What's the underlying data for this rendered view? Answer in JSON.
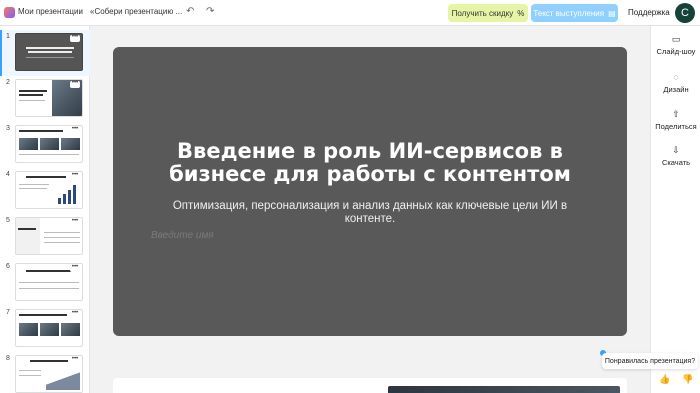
{
  "header": {
    "breadcrumb_home": "Мои презентации",
    "breadcrumb_sep": "›",
    "presentation_title": "«Собери презентацию ...",
    "undo_icon": "↶",
    "redo_icon": "↷",
    "discount_label": "Получить скидку",
    "discount_icon": "%",
    "speech_label": "Текст выступления",
    "speech_icon": "▤",
    "support_label": "Поддержка",
    "avatar_letter": "C"
  },
  "thumbnails": [
    {
      "num": "1"
    },
    {
      "num": "2"
    },
    {
      "num": "3"
    },
    {
      "num": "4"
    },
    {
      "num": "5"
    },
    {
      "num": "6"
    },
    {
      "num": "7"
    },
    {
      "num": "8"
    }
  ],
  "thumb_menu": "•••",
  "slide": {
    "title": "Введение в роль ИИ-сервисов в бизнесе для работы с контентом",
    "subtitle": "Оптимизация, персонализация и анализ данных как ключевые цели ИИ в контенте.",
    "name_placeholder": "Введите имя"
  },
  "tools": [
    {
      "icon": "▭",
      "label": "Слайд-шоу"
    },
    {
      "icon": "◌",
      "label": "Дизайн"
    },
    {
      "icon": "⇧",
      "label": "Поделиться"
    },
    {
      "icon": "⇩",
      "label": "Скачать"
    }
  ],
  "feedback": {
    "question": "Понравилась презентация?",
    "like_icon": "👍",
    "dislike_icon": "👎"
  },
  "colors": {
    "slide_background": "#595959",
    "discount_button": "#e6f4a6",
    "speech_button": "#8fd0ff",
    "avatar": "#17423a",
    "accent": "#3aa0ff"
  }
}
